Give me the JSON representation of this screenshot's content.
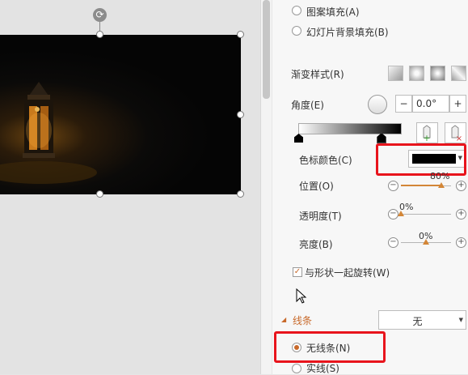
{
  "fill_options": {
    "pattern_fill": "图案填充(A)",
    "slide_bg_fill": "幻灯片背景填充(B)"
  },
  "gradient": {
    "style_label": "渐变样式(R)",
    "angle_label": "角度(E)",
    "angle_value": "0.0°",
    "decrement": "−",
    "increment": "+",
    "stop_color_label": "色标颜色(C)",
    "stop_color": "#000000",
    "position_label": "位置(O)",
    "position_value": "80%",
    "position_fraction": 0.8,
    "transparency_label": "透明度(T)",
    "transparency_value": "0%",
    "transparency_fraction": 0.0,
    "brightness_label": "亮度(B)",
    "brightness_value": "0%",
    "brightness_fraction": 0.5,
    "rotate_with_shape": "与形状一起旋转(W)",
    "rotate_with_shape_checked": true
  },
  "line": {
    "section_label": "线条",
    "dropdown_value": "无",
    "no_line": "无线条(N)",
    "solid_line": "实线(S)"
  },
  "colors": {
    "accent": "#c8692a",
    "highlight": "#e8141c",
    "slider": "#d38637"
  }
}
